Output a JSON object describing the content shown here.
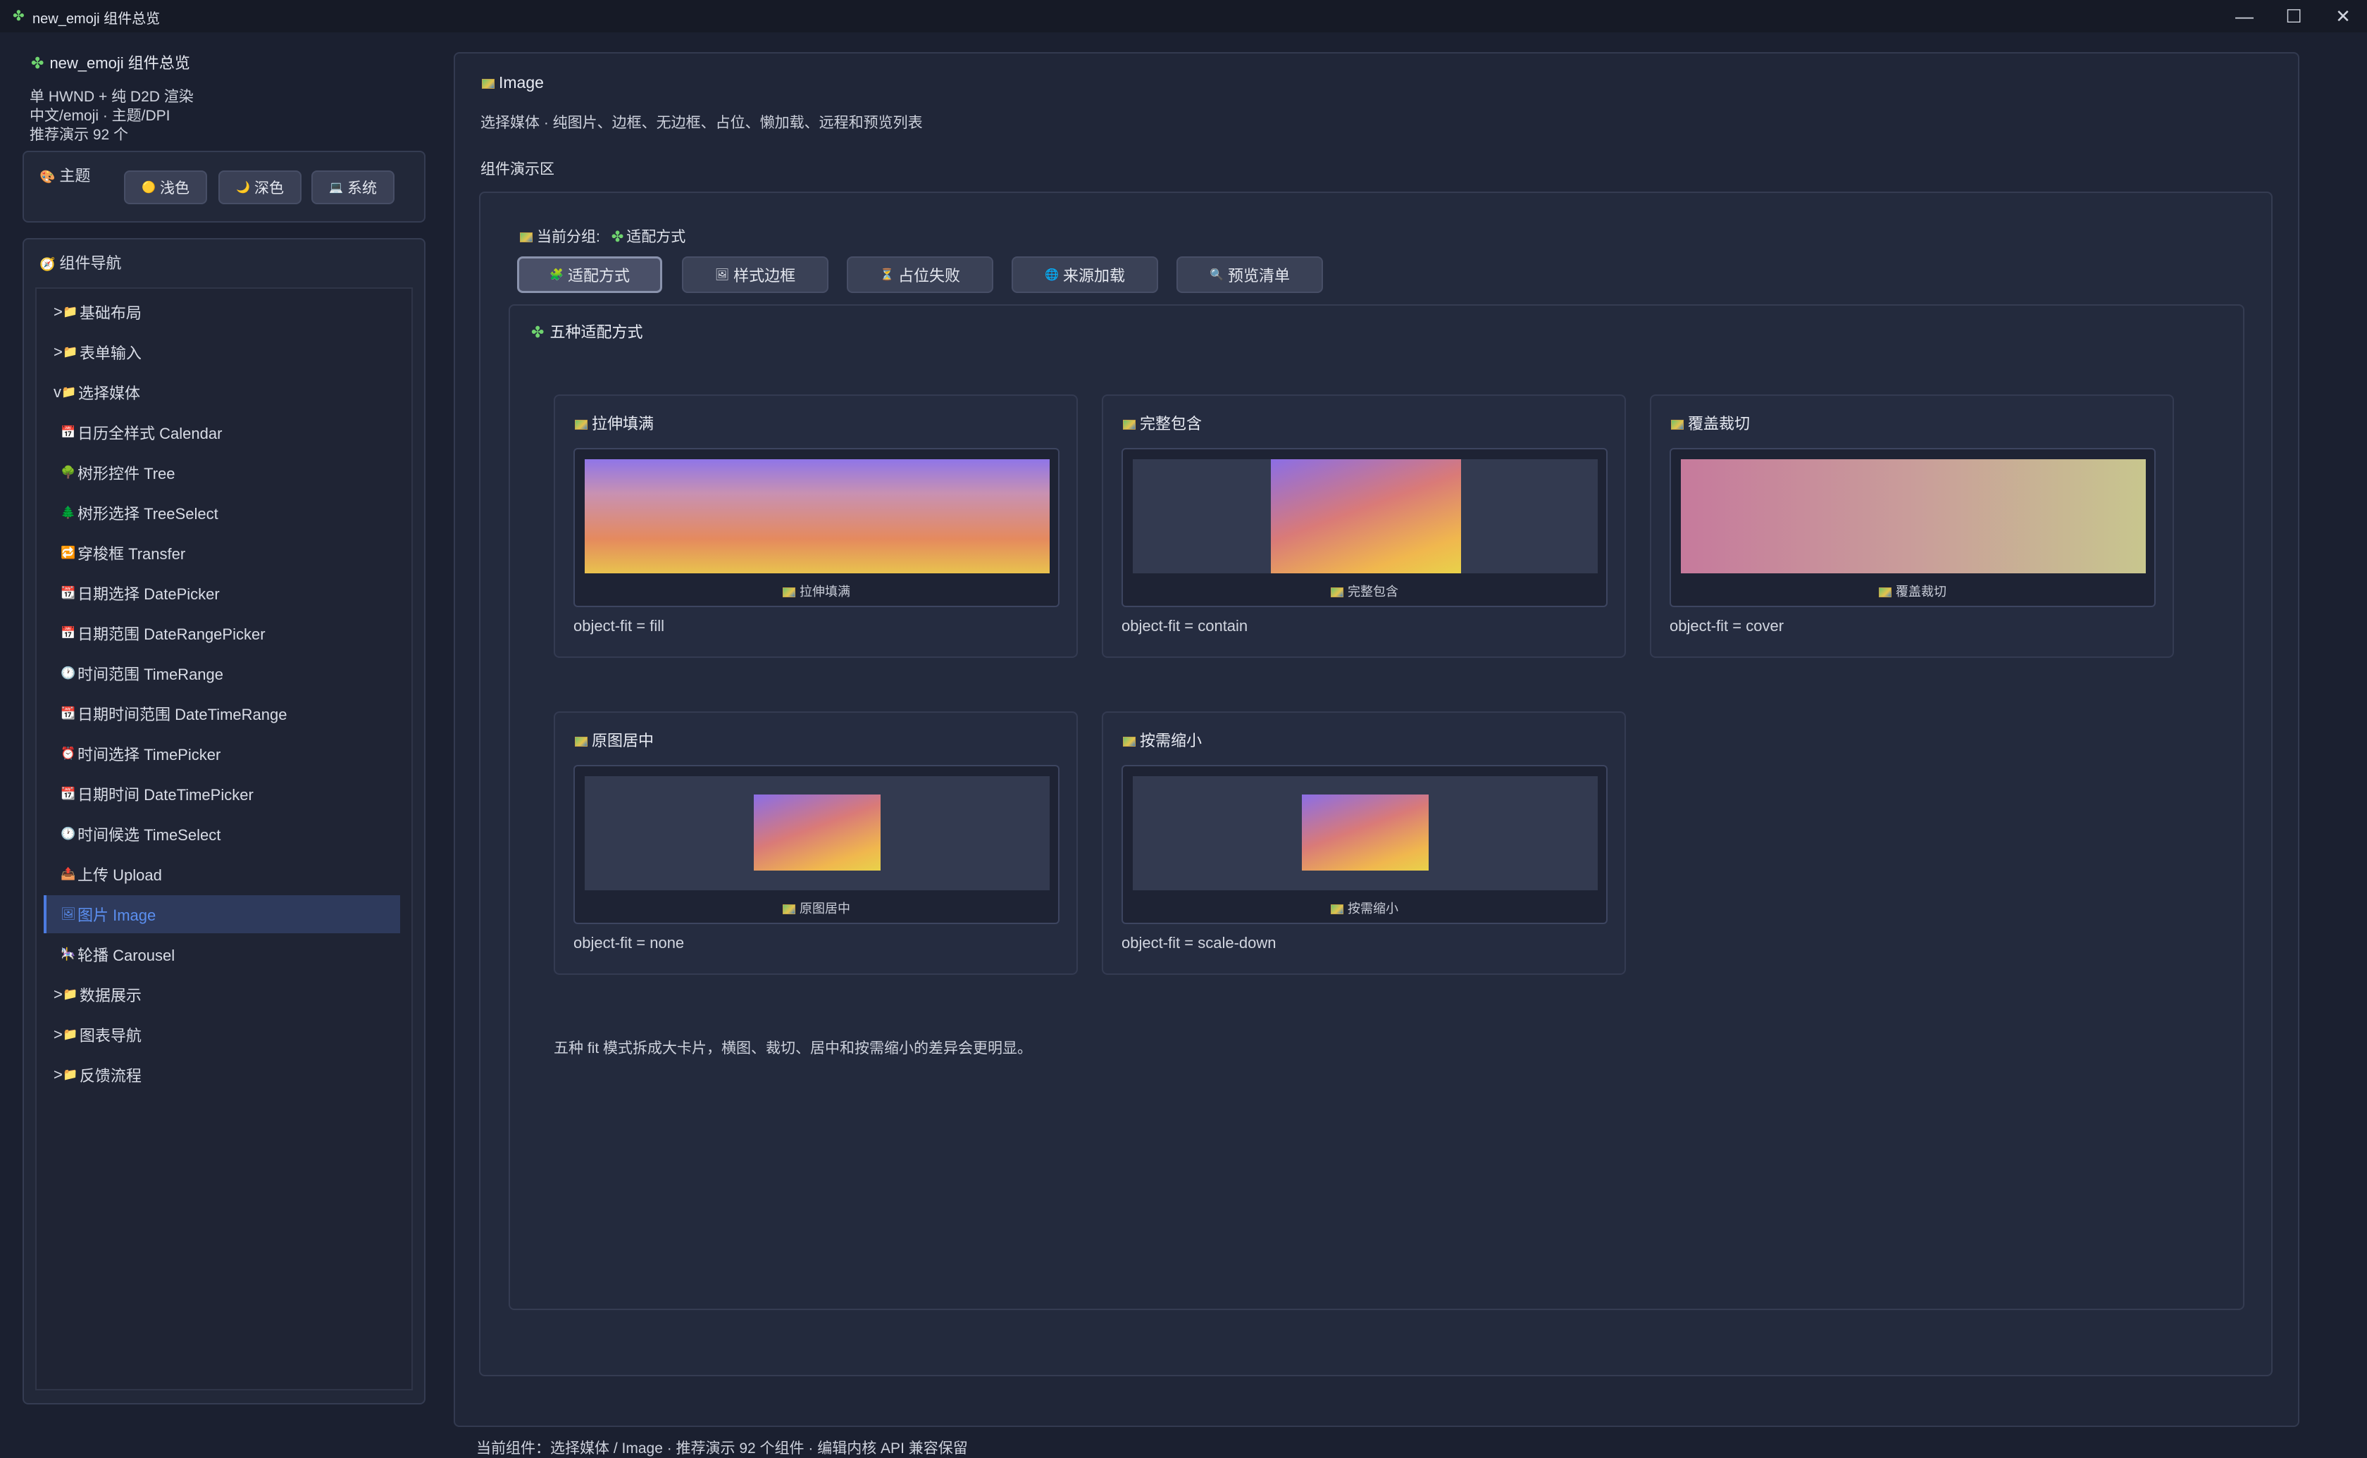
{
  "window": {
    "title": "new_emoji 组件总览",
    "controls": [
      "—",
      "☐",
      "✕"
    ]
  },
  "sidebar": {
    "app_title": "new_emoji 组件总览",
    "info_lines": [
      "单 HWND + 纯 D2D 渲染",
      "中文/emoji · 主题/DPI",
      "推荐演示 92 个"
    ],
    "theme": {
      "label": "主题",
      "buttons": [
        {
          "icon": "🟡",
          "label": "浅色"
        },
        {
          "icon": "🌙",
          "label": "深色"
        },
        {
          "icon": "💻",
          "label": "系统"
        }
      ]
    },
    "nav": {
      "label": "组件导航",
      "items": [
        {
          "prefix": ">",
          "icon": "📁",
          "label": "基础布局"
        },
        {
          "prefix": ">",
          "icon": "📁",
          "label": "表单输入"
        },
        {
          "prefix": "v",
          "icon": "📁",
          "label": "选择媒体"
        },
        {
          "prefix": "",
          "icon": "📅",
          "label": "日历全样式 Calendar"
        },
        {
          "prefix": "",
          "icon": "🌳",
          "label": "树形控件 Tree"
        },
        {
          "prefix": "",
          "icon": "🌲",
          "label": "树形选择 TreeSelect"
        },
        {
          "prefix": "",
          "icon": "🔁",
          "label": "穿梭框 Transfer"
        },
        {
          "prefix": "",
          "icon": "📆",
          "label": "日期选择 DatePicker"
        },
        {
          "prefix": "",
          "icon": "📅",
          "label": "日期范围 DateRangePicker"
        },
        {
          "prefix": "",
          "icon": "🕐",
          "label": "时间范围 TimeRange"
        },
        {
          "prefix": "",
          "icon": "📆",
          "label": "日期时间范围 DateTimeRange"
        },
        {
          "prefix": "",
          "icon": "⏰",
          "label": "时间选择 TimePicker"
        },
        {
          "prefix": "",
          "icon": "📆",
          "label": "日期时间 DateTimePicker"
        },
        {
          "prefix": "",
          "icon": "🕐",
          "label": "时间候选 TimeSelect"
        },
        {
          "prefix": "",
          "icon": "📤",
          "label": "上传 Upload"
        },
        {
          "prefix": "",
          "icon": "🖼",
          "label": "图片 Image"
        },
        {
          "prefix": "",
          "icon": "🎠",
          "label": "轮播 Carousel"
        },
        {
          "prefix": ">",
          "icon": "📁",
          "label": "数据展示"
        },
        {
          "prefix": ">",
          "icon": "📁",
          "label": "图表导航"
        },
        {
          "prefix": ">",
          "icon": "📁",
          "label": "反馈流程"
        }
      ],
      "selected_index": 15
    }
  },
  "main": {
    "title": "Image",
    "description": "选择媒体 · 纯图片、边框、无边框、占位、懒加载、远程和预览列表",
    "demo_area_label": "组件演示区",
    "current_group_label": "当前分组:",
    "current_group_value": "适配方式",
    "tabs": [
      {
        "icon": "🧩",
        "label": "适配方式"
      },
      {
        "icon": "🖼",
        "label": "样式边框"
      },
      {
        "icon": "⏳",
        "label": "占位失败"
      },
      {
        "icon": "🌐",
        "label": "来源加载"
      },
      {
        "icon": "🔍",
        "label": "预览清单"
      }
    ],
    "active_tab": 0,
    "section_title": "五种适配方式",
    "cards": [
      {
        "title": "拉伸填满",
        "caption": "拉伸填满",
        "fit": "object-fit = fill"
      },
      {
        "title": "完整包含",
        "caption": "完整包含",
        "fit": "object-fit = contain"
      },
      {
        "title": "覆盖裁切",
        "caption": "覆盖裁切",
        "fit": "object-fit = cover"
      },
      {
        "title": "原图居中",
        "caption": "原图居中",
        "fit": "object-fit = none"
      },
      {
        "title": "按需缩小",
        "caption": "按需缩小",
        "fit": "object-fit = scale-down"
      }
    ],
    "note": "五种 fit 模式拆成大卡片，横图、裁切、居中和按需缩小的差异会更明显。"
  },
  "statusbar": {
    "text": "当前组件：选择媒体 / Image · 推荐演示 92 个组件 · 编辑内核 API 兼容保留"
  },
  "colors": {
    "background": "#1b2030",
    "panel": "#222839",
    "accent": "#4c7be0",
    "selected_text": "#5b8ff0"
  }
}
